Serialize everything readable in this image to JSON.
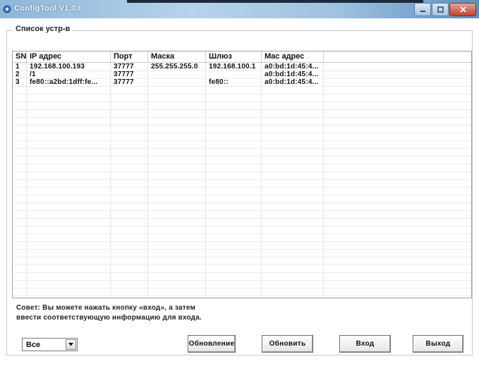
{
  "window": {
    "title": "ConfigTool V1.0.0",
    "colors": {
      "titlebar": "#9fc2e0",
      "close_button": "#c4412f"
    },
    "icons": {
      "app": "app-icon",
      "minimize": "minimize-icon",
      "maximize": "maximize-icon",
      "close": "close-icon"
    }
  },
  "group": {
    "legend": "Список устр-в"
  },
  "table": {
    "columns": [
      "SN",
      "IP адрес",
      "Порт",
      "Маска",
      "Шлюз",
      "Mac адрес",
      ""
    ],
    "rows": [
      [
        "1",
        "192.168.100.193",
        "37777",
        "255.255.255.0",
        "192.168.100.1",
        "a0:bd:1d:45:4...",
        ""
      ],
      [
        "2",
        "/1",
        "37777",
        "",
        "",
        "a0:bd:1d:45:4...",
        ""
      ],
      [
        "3",
        "fe80::a2bd:1dff:fe...",
        "37777",
        "",
        "fe80::",
        "a0:bd:1d:45:4...",
        ""
      ]
    ]
  },
  "tip": {
    "line1": "Совет: Вы можете нажать кнопку «вход», а затем",
    "line2": "ввести соответствующую информацию для входа."
  },
  "filter": {
    "selected": "Все",
    "icon": "chevron-down-icon"
  },
  "buttons": {
    "refresh_all": "Обновление",
    "update": "Обновить",
    "login": "Вход",
    "exit": "Выход"
  }
}
